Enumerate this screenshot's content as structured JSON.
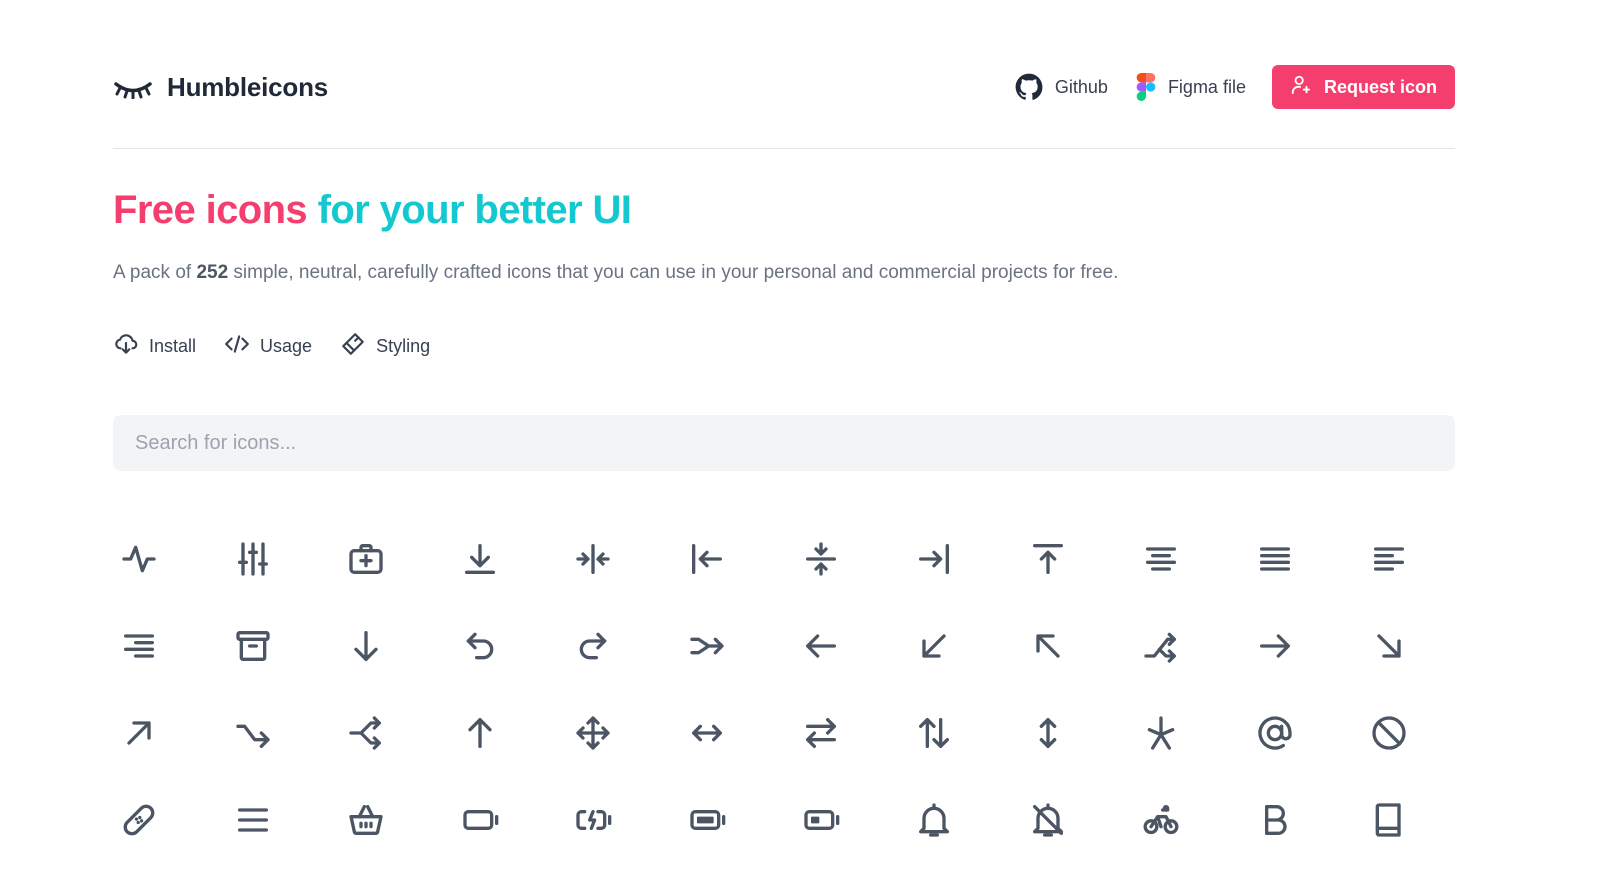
{
  "brand": {
    "name": "Humbleicons",
    "logo_icon": "closed-eye-icon"
  },
  "nav": {
    "github_label": "Github",
    "figma_label": "Figma file",
    "request_label": "Request icon"
  },
  "colors": {
    "accent_pink": "#f43f6e",
    "accent_teal": "#14c8d0"
  },
  "hero": {
    "title_part1": "Free icons",
    "title_part2": "for your better UI",
    "desc_before": "A pack of ",
    "desc_count": "252",
    "desc_after": " simple, neutral, carefully crafted icons that you can use in your personal and commercial projects for free."
  },
  "doc_links": [
    {
      "label": "Install",
      "icon": "cloud-download-icon"
    },
    {
      "label": "Usage",
      "icon": "code-icon"
    },
    {
      "label": "Styling",
      "icon": "brush-icon"
    }
  ],
  "search": {
    "placeholder": "Search for icons..."
  },
  "icons": [
    "activity-icon",
    "adjustments-icon",
    "aid-kit-icon",
    "download-alt-icon",
    "align-center-horizontal-icon",
    "align-left-arrow-icon",
    "align-center-vertical-icon",
    "align-right-arrow-icon",
    "align-top-icon",
    "text-align-center-icon",
    "text-align-justify-icon",
    "text-align-left-icon",
    "text-align-right-icon",
    "archive-icon",
    "arrow-down-icon",
    "arrow-go-back-icon",
    "arrow-go-forward-icon",
    "arrow-merge-icon",
    "arrow-left-icon",
    "arrow-left-down-icon",
    "arrow-left-up-icon",
    "arrow-split-icon",
    "arrow-right-icon",
    "arrow-right-down-icon",
    "arrow-right-up-icon",
    "arrow-shuffle-right-icon",
    "arrow-split-left-icon",
    "arrow-up-icon",
    "arrows-move-icon",
    "arrows-horizontal-icon",
    "arrows-switch-icon",
    "arrows-up-down-icon",
    "arrows-vertical-icon",
    "asterisk-icon",
    "at-symbol-icon",
    "ban-icon",
    "bandage-icon",
    "bars-icon",
    "basket-icon",
    "battery-empty-icon",
    "battery-charging-icon",
    "battery-full-icon",
    "battery-half-icon",
    "bell-icon",
    "bell-off-icon",
    "bicycle-icon",
    "bold-icon",
    "book-icon"
  ]
}
